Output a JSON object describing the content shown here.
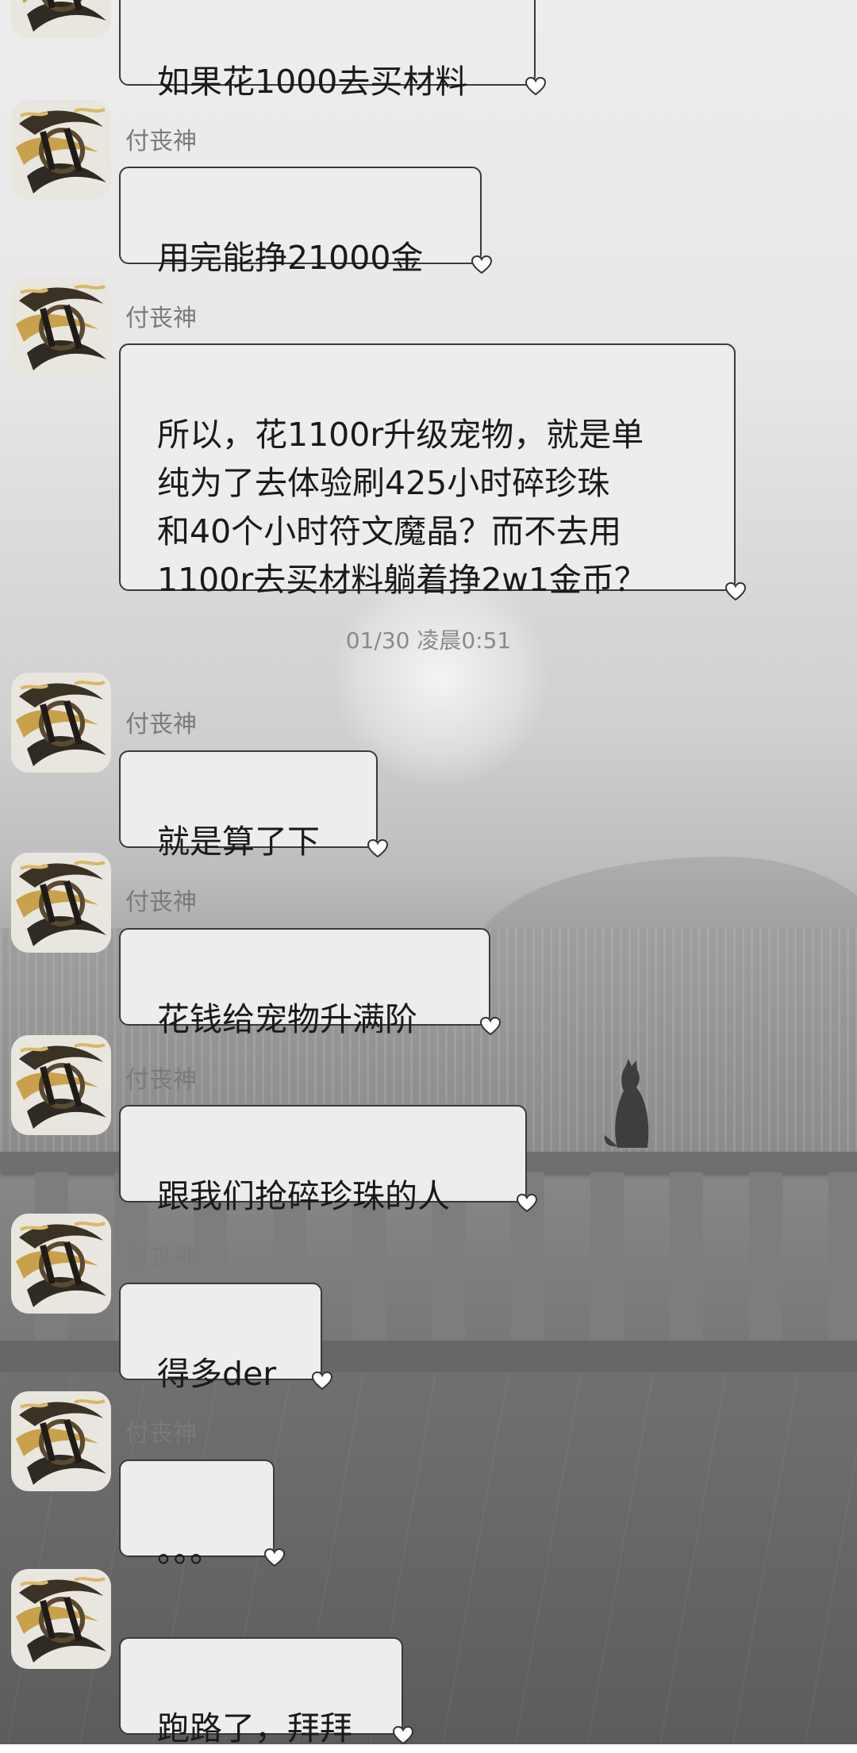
{
  "theme": {
    "bubble_bg": "#ededed",
    "bubble_border": "#3a3a3a",
    "sender_color": "#7a7a7a"
  },
  "timestamp": "01/30 凌晨0:51",
  "messages": [
    {
      "sender": "",
      "text": "如果花1000去买材料"
    },
    {
      "sender": "付丧神",
      "text": "用完能挣21000金"
    },
    {
      "sender": "付丧神",
      "text": "所以，花1100r升级宠物，就是单\n纯为了去体验刷425小时碎珍珠\n和40个小时符文魔晶？而不去用\n1100r去买材料躺着挣2w1金币？"
    },
    {
      "sender": "付丧神",
      "text": "就是算了下"
    },
    {
      "sender": "付丧神",
      "text": "花钱给宠物升满阶"
    },
    {
      "sender": "付丧神",
      "text": "跟我们抢碎珍珠的人"
    },
    {
      "sender": "付丧神",
      "text": "得多der"
    },
    {
      "sender": "付丧神",
      "text": "。。。"
    },
    {
      "sender": "",
      "text": "跑路了，拜拜"
    }
  ]
}
